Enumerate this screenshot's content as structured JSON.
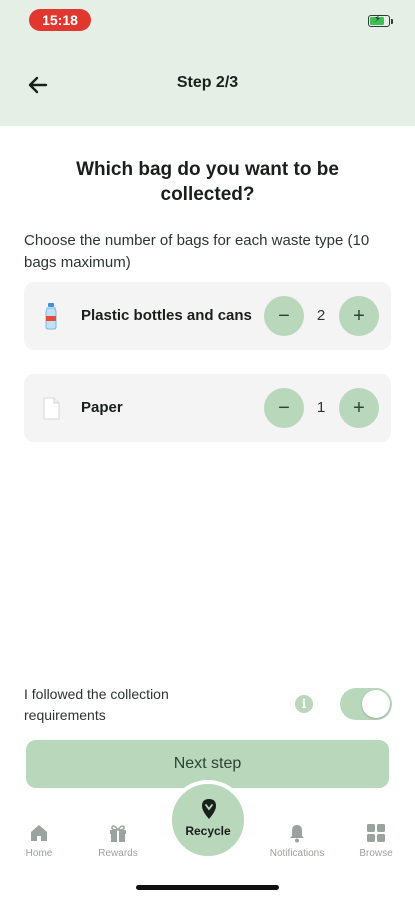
{
  "status_bar": {
    "time": "15:18",
    "battery_level": 0.7
  },
  "header": {
    "title": "Step 2/3",
    "back_icon": "arrow-left-icon"
  },
  "main": {
    "heading": "Which bag do you want to be collected?",
    "instruction": "Choose the number of bags for each waste type (10 bags maximum)",
    "items": [
      {
        "label": "Plastic bottles and cans",
        "icon": "plastic-bottle-icon",
        "count": "2"
      },
      {
        "label": "Paper",
        "icon": "paper-icon",
        "count": "1"
      }
    ]
  },
  "confirmation": {
    "label": "I followed the collection requirements",
    "toggle_on": true,
    "info_icon": "info-icon"
  },
  "next_button": {
    "label": "Next step"
  },
  "tabbar": {
    "items": [
      {
        "label": "Home",
        "icon": "home-icon"
      },
      {
        "label": "Rewards",
        "icon": "gift-icon"
      },
      {
        "label": "Recycle",
        "icon": "recycle-icon"
      },
      {
        "label": "Notifications",
        "icon": "bell-icon"
      },
      {
        "label": "Browse",
        "icon": "grid-icon"
      }
    ]
  },
  "colors": {
    "header_bg": "#e5efe6",
    "accent": "#b9d7bb",
    "time_badge": "#e0372f",
    "card_bg": "#f3f4f3"
  }
}
